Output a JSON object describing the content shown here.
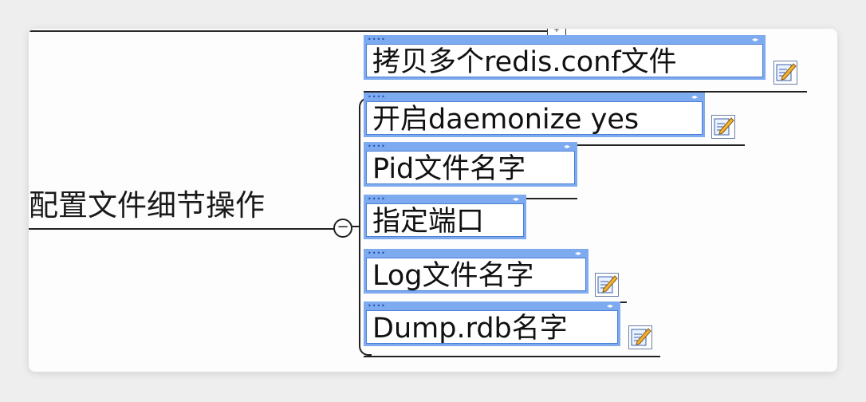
{
  "mindmap": {
    "central_topic": "配置文件细节操作",
    "collapse_symbol": "−",
    "top_handle_symbol": "+",
    "subtopics": [
      {
        "label": "拷贝多个redis.conf文件",
        "has_note": true
      },
      {
        "label": "开启daemonize yes",
        "has_note": true
      },
      {
        "label": "Pid文件名字",
        "has_note": false
      },
      {
        "label": "指定端口",
        "has_note": false
      },
      {
        "label": "Log文件名字",
        "has_note": true
      },
      {
        "label": "Dump.rdb名字",
        "has_note": true
      }
    ],
    "colors": {
      "node_border": "#7eaaf0",
      "node_accent": "#4a7fd6",
      "line": "#222222"
    },
    "note_icon": "note-pencil-icon"
  }
}
